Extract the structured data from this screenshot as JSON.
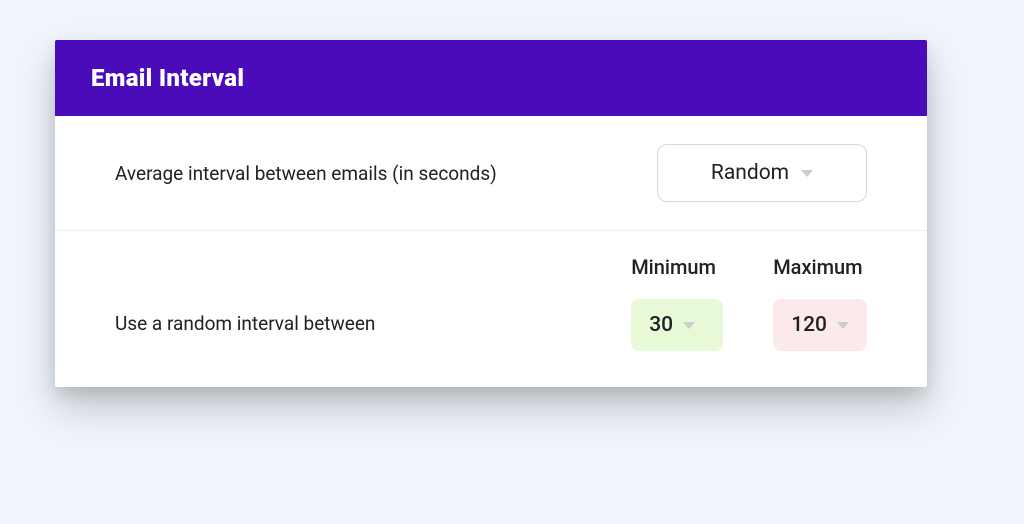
{
  "panel": {
    "title": "Email Interval"
  },
  "avg": {
    "label": "Average interval between emails (in seconds)",
    "value": "Random"
  },
  "range": {
    "label": "Use a random interval between",
    "min_label": "Minimum",
    "max_label": "Maximum",
    "min_value": "30",
    "max_value": "120"
  }
}
